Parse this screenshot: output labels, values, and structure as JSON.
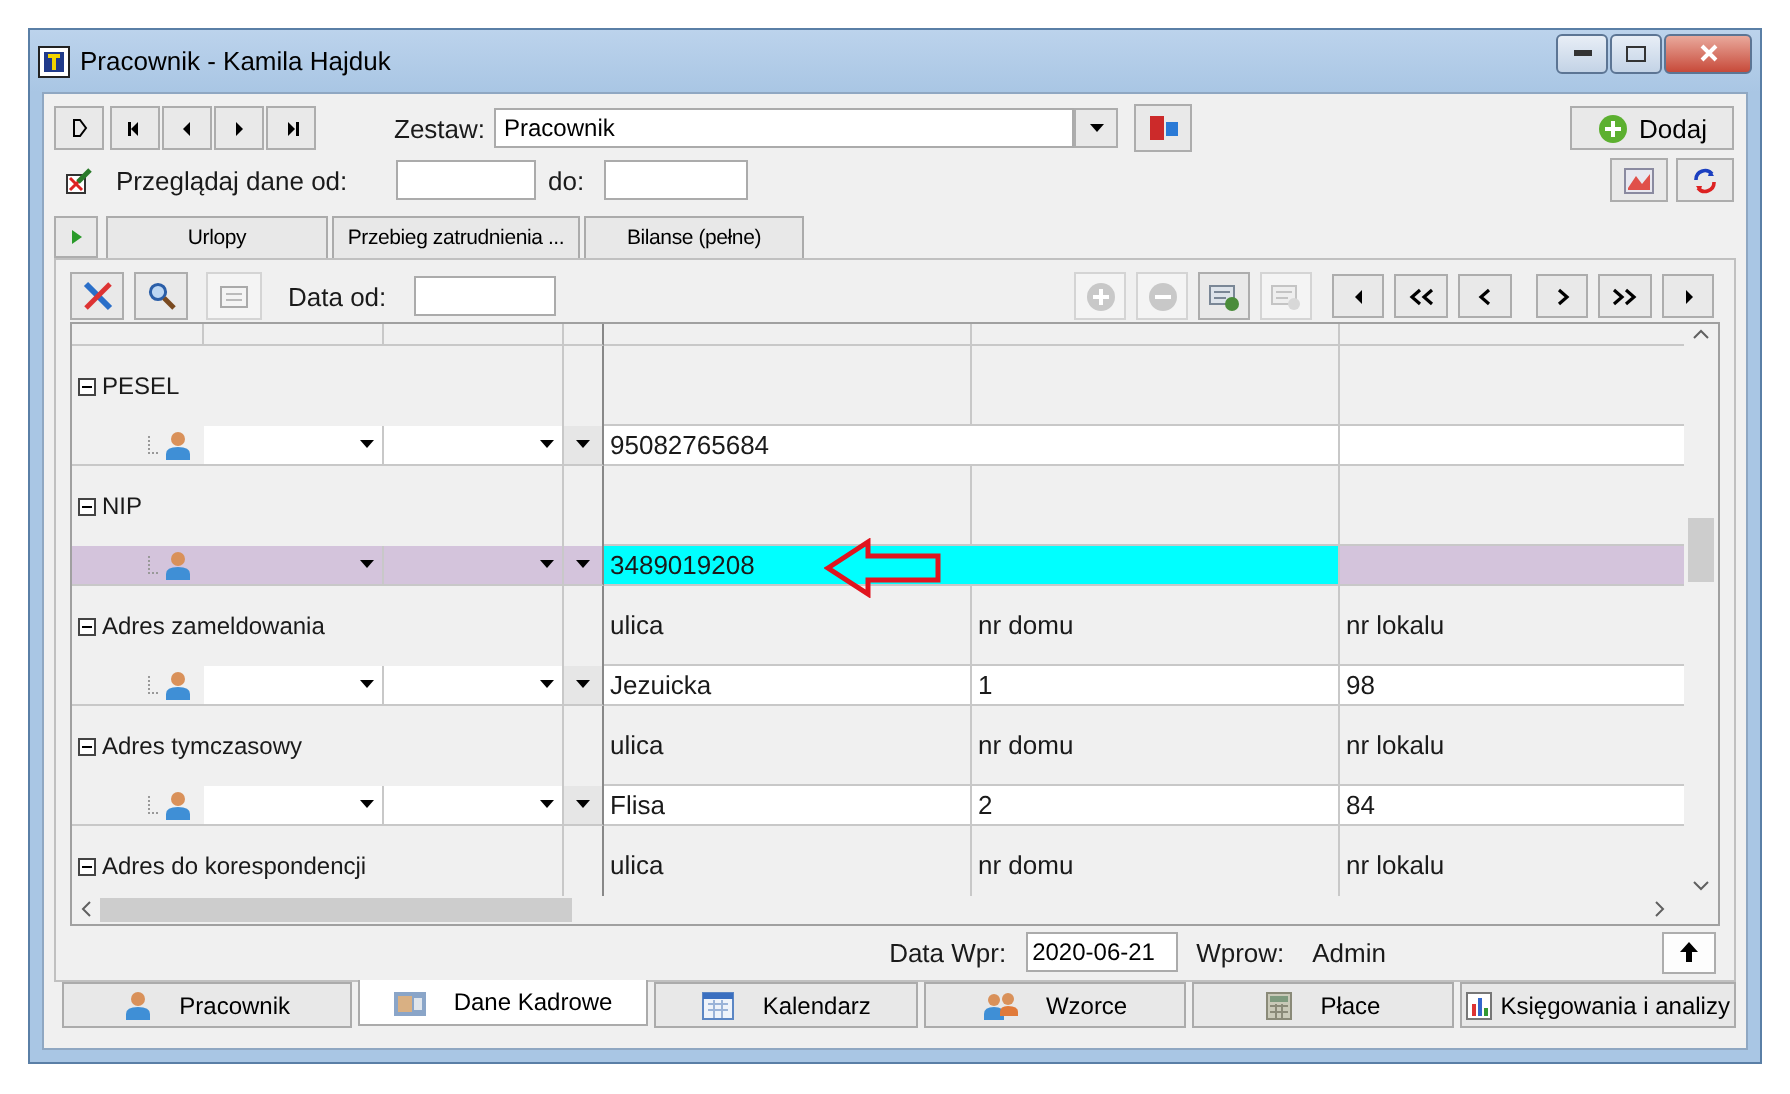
{
  "window": {
    "title": "Pracownik - Kamila Hajduk"
  },
  "set": {
    "label": "Zestaw:",
    "value": "Pracownik"
  },
  "add_button": "Dodaj",
  "filter": {
    "label": "Przeglądaj dane od:",
    "to_label": "do:"
  },
  "tabs": [
    {
      "label": "Urlopy",
      "selected": false
    },
    {
      "label": "Przebieg zatrudnienia ...",
      "selected": false
    },
    {
      "label": "Bilanse (pełne)",
      "selected": false
    }
  ],
  "grid_toolbar": {
    "date_label": "Data od:",
    "tools": [
      {
        "kind": "plus",
        "disabled": true
      },
      {
        "kind": "minus",
        "disabled": true
      },
      {
        "kind": "add-card",
        "disabled": false
      },
      {
        "kind": "card",
        "disabled": true
      }
    ]
  },
  "groups": [
    {
      "label": "PESEL",
      "rows": [
        {
          "values": [
            "95082765684"
          ],
          "selected": false
        }
      ]
    },
    {
      "label": "NIP",
      "rows": [
        {
          "values": [
            "3489019208"
          ],
          "selected": true
        }
      ]
    },
    {
      "label": "Adres zameldowania",
      "headers": [
        "ulica",
        "nr domu",
        "nr lokalu"
      ],
      "rows": [
        {
          "values": [
            "Jezuicka",
            "1",
            "98"
          ],
          "selected": false
        }
      ]
    },
    {
      "label": "Adres tymczasowy",
      "headers": [
        "ulica",
        "nr domu",
        "nr lokalu"
      ],
      "rows": [
        {
          "values": [
            "Flisa",
            "2",
            "84"
          ],
          "selected": false
        }
      ]
    },
    {
      "label": "Adres do korespondencji",
      "headers": [
        "ulica",
        "nr domu",
        "nr lokalu"
      ]
    }
  ],
  "status": {
    "date_label": "Data Wpr:",
    "date_value": "2020-06-21",
    "user_label": "Wprow:",
    "user": "Admin"
  },
  "bottom_tabs": [
    {
      "label": "Pracownik",
      "kind": "person",
      "selected": false
    },
    {
      "label": "Dane Kadrowe",
      "kind": "folder",
      "selected": true
    },
    {
      "label": "Kalendarz",
      "kind": "calendar",
      "selected": false
    },
    {
      "label": "Wzorce",
      "kind": "people",
      "selected": false
    },
    {
      "label": "Płace",
      "kind": "calculator",
      "selected": false
    },
    {
      "label": "Księgowania i analizy",
      "kind": "chart",
      "selected": false
    }
  ]
}
